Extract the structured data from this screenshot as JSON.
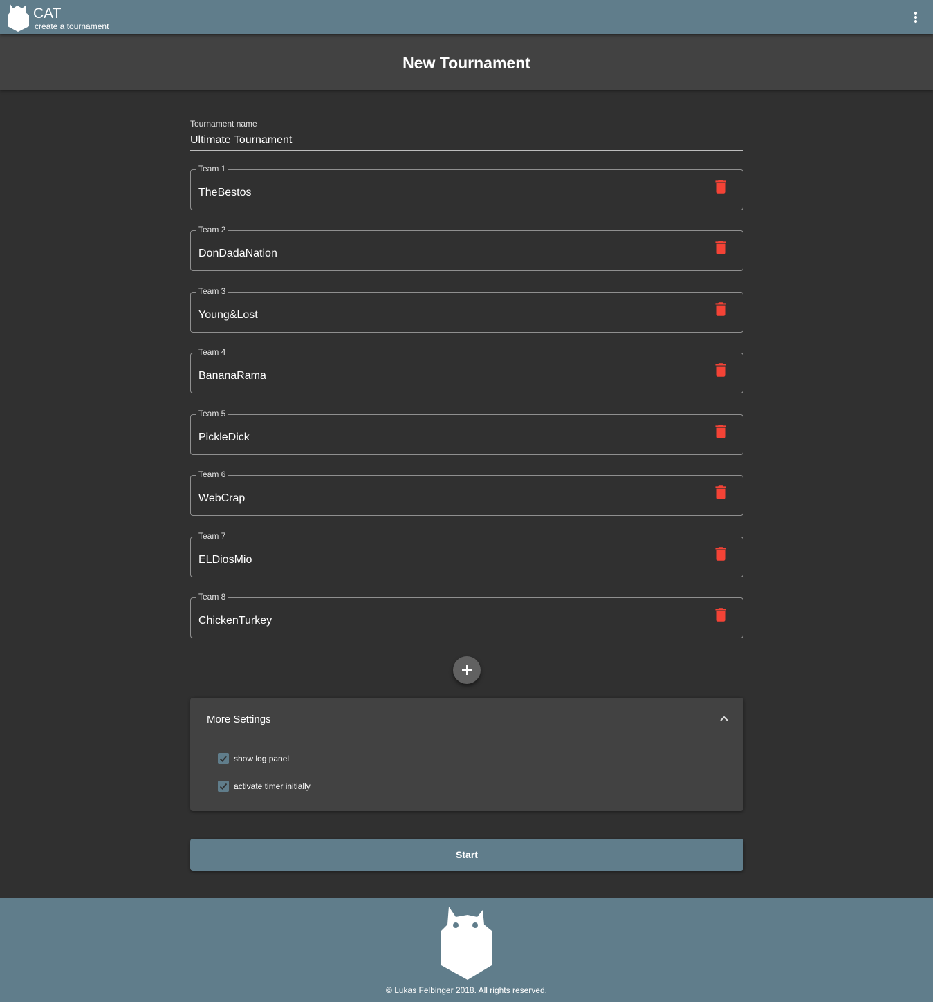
{
  "appbar": {
    "title": "CAT",
    "subtitle": "create a tournament",
    "menu_icon": "more-vert-icon"
  },
  "page": {
    "heading": "New Tournament"
  },
  "form": {
    "name_label": "Tournament name",
    "name_value": "Ultimate Tournament",
    "teams": [
      {
        "label": "Team 1",
        "value": "TheBestos"
      },
      {
        "label": "Team 2",
        "value": "DonDadaNation"
      },
      {
        "label": "Team 3",
        "value": "Young&Lost"
      },
      {
        "label": "Team 4",
        "value": "BananaRama"
      },
      {
        "label": "Team 5",
        "value": "PickleDick"
      },
      {
        "label": "Team 6",
        "value": "WebCrap"
      },
      {
        "label": "Team 7",
        "value": "ELDiosMio"
      },
      {
        "label": "Team 8",
        "value": "ChickenTurkey"
      }
    ],
    "delete_icon": "trash-icon",
    "add_icon": "plus-icon"
  },
  "settings": {
    "title": "More Settings",
    "expanded": true,
    "options": [
      {
        "label": "show log panel",
        "checked": true
      },
      {
        "label": "activate timer initially",
        "checked": true
      }
    ]
  },
  "start_label": "Start",
  "footer": {
    "copyright": "© Lukas Felbinger 2018. All rights reserved."
  },
  "colors": {
    "primary": "#607d8b",
    "background": "#303030",
    "surface": "#424242",
    "delete": "#f44336"
  }
}
